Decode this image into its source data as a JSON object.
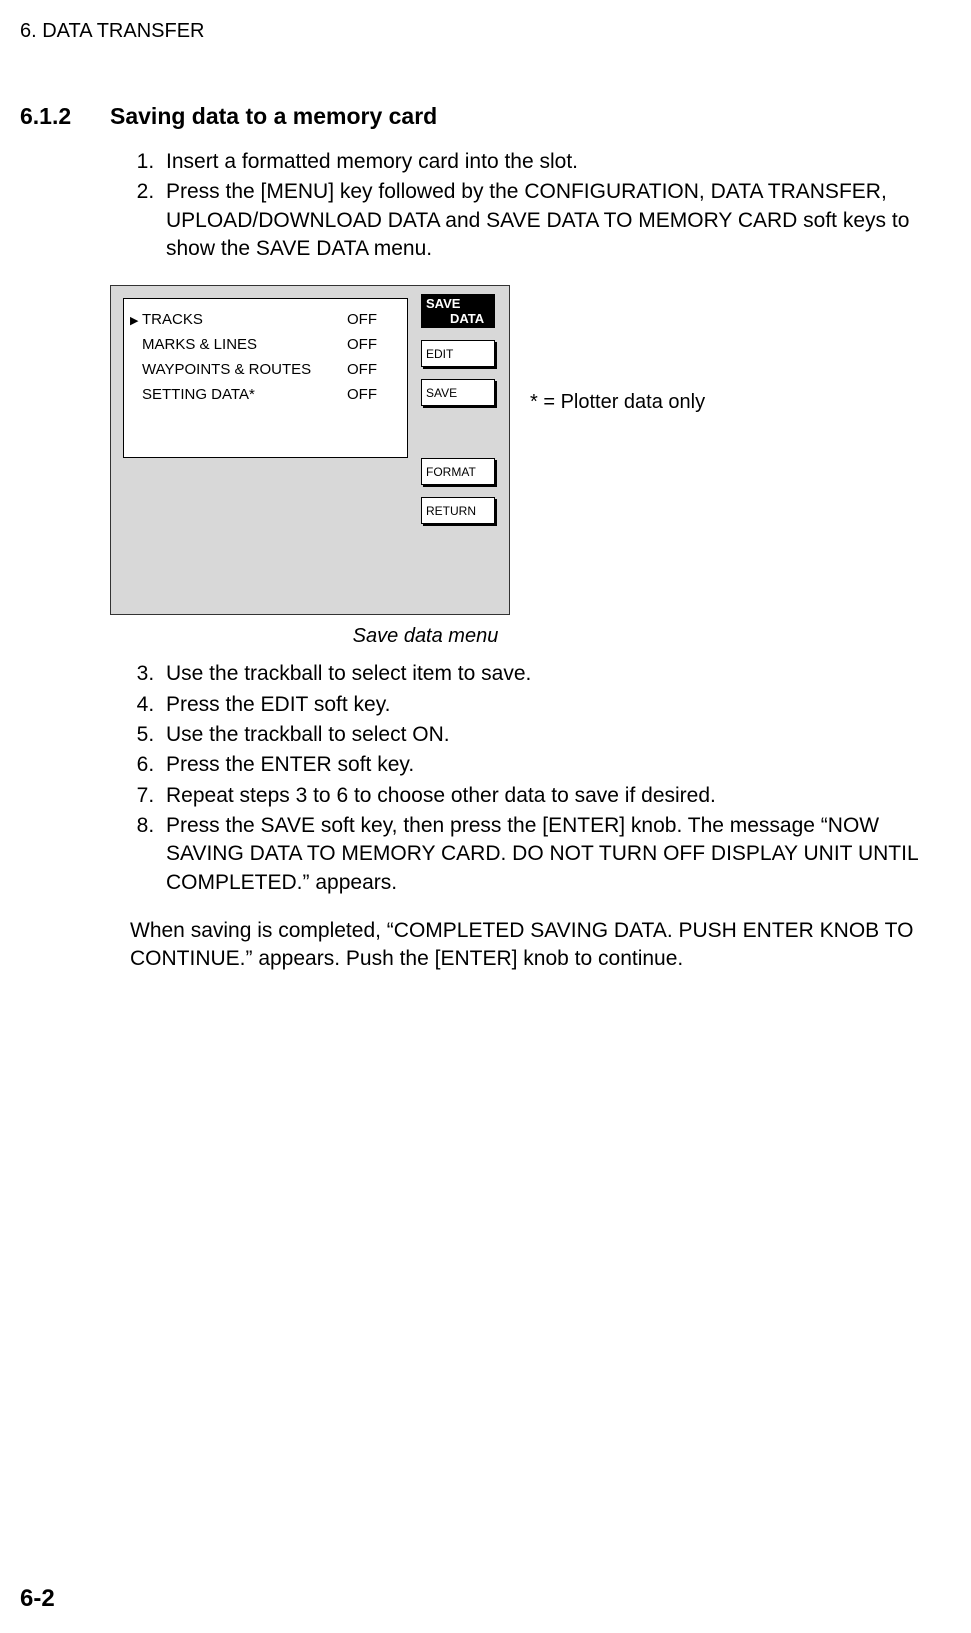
{
  "chapter_header": "6. DATA TRANSFER",
  "section_number": "6.1.2",
  "section_title": "Saving data to a memory card",
  "steps_top": [
    "Insert a formatted memory card into the slot.",
    "Press the [MENU] key followed by the CONFIGURATION, DATA TRANSFER, UPLOAD/DOWNLOAD DATA and SAVE DATA TO MEMORY CARD soft keys to show the SAVE DATA menu."
  ],
  "menu_rows": [
    {
      "cursor": "▶",
      "label": "TRACKS",
      "value": "OFF"
    },
    {
      "cursor": "",
      "label": "MARKS & LINES",
      "value": "OFF"
    },
    {
      "cursor": "",
      "label": "WAYPOINTS & ROUTES",
      "value": "OFF"
    },
    {
      "cursor": "",
      "label": "SETTING DATA*",
      "value": "OFF"
    }
  ],
  "softkeys": {
    "active_line1": "SAVE",
    "active_line2": "DATA",
    "edit": "EDIT",
    "save": "SAVE",
    "format": "FORMAT",
    "return": "RETURN"
  },
  "annotation": "* = Plotter data only",
  "figure_caption": "Save data menu",
  "steps_bottom": [
    "Use the trackball to select item to save.",
    "Press the EDIT soft key.",
    "Use the trackball to select ON.",
    "Press the ENTER soft key.",
    "Repeat steps 3 to 6 to choose other data to save if desired.",
    "Press the SAVE soft key, then press the [ENTER] knob. The message “NOW SAVING DATA TO MEMORY CARD. DO NOT TURN OFF DISPLAY UNIT UNTIL COMPLETED.” appears."
  ],
  "closing_para": "When saving is completed, “COMPLETED SAVING DATA. PUSH ENTER KNOB TO CONTINUE.” appears. Push the [ENTER] knob to continue.",
  "page_number": "6-2"
}
